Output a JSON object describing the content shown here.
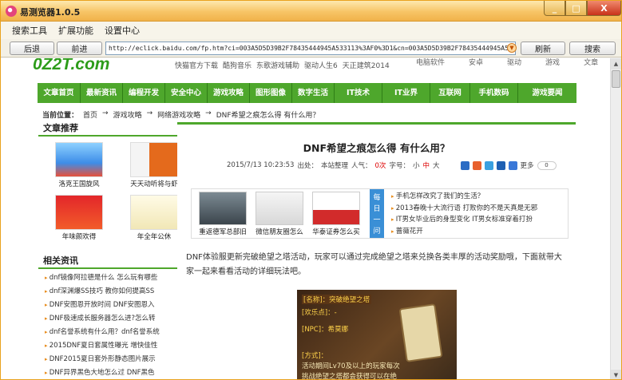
{
  "window": {
    "title": "易测览器1.0.5",
    "controls": [
      "_",
      "□",
      "X"
    ]
  },
  "menubar": {
    "items": [
      "搜索工具",
      "扩展功能",
      "设置中心"
    ]
  },
  "toolbar": {
    "back": "后退",
    "forward": "前进",
    "address": "http://eclick.baidu.com/fp.htm?ci=003A5D5D39B2F78435444945A533113%3AF0%3D1&cn=003A5D5D39B2F78435444945A533113%3AF0%3",
    "refresh": "刷新",
    "search": "搜索"
  },
  "site": {
    "logo": "0Z2T.com",
    "top_links": [
      "快猫官方下载",
      "酷狗音乐",
      "东歌游戏辅助",
      "驱动人生6",
      "天正建筑2014"
    ],
    "top_nav": [
      "电脑软件",
      "安卓",
      "驱动",
      "游戏",
      "文章"
    ],
    "categories": [
      "文章首页",
      "最新资讯",
      "编程开发",
      "安全中心",
      "游戏攻略",
      "图形图像",
      "数字生活",
      "IT技术",
      "IT业界",
      "互联网",
      "手机数码",
      "游戏要闻"
    ],
    "breadcrumb": {
      "label": "当前位置：",
      "items": [
        "首页",
        "游戏攻略",
        "网络游戏攻略",
        "DNF希望之痕怎么得 有什么用？"
      ],
      "sep": "→"
    }
  },
  "sidebar": {
    "recommend_title": "文章推荐",
    "recommend": [
      {
        "caption": "洛克王国旋风"
      },
      {
        "caption": "天天动听将与虾"
      },
      {
        "caption": "年味颇欢得"
      },
      {
        "caption": "年全年公休"
      }
    ],
    "related_title": "相关资讯",
    "related": [
      "dnf镜像阿拉德是什么 怎么玩有哪些",
      "dnf深渊爆SS技巧 教你如何提高SS",
      "DNF安图恩开放时间 DNF安图恩入",
      "DNF极速成长服务器怎么进?怎么转",
      "dnf名誉系统有什么用？dnf名誉系统",
      "2015DNF夏日套属性曝光 增快佳性",
      "DNF2015夏日套外形静态图片展示",
      "DNF异界黑色大地怎么过 DNF黑色"
    ]
  },
  "article": {
    "title": "DNF希望之痕怎么得 有什么用？",
    "date": "2015/7/13 10:23:53",
    "source_label": "出处：",
    "source": "本站整理",
    "popularity_label": "人气：",
    "popularity": "0次",
    "font_label": "字号：",
    "font_small": "小",
    "font_medium": "中",
    "font_large": "大",
    "share_more": "更多",
    "share_count": "0",
    "featured": [
      {
        "caption": "重返德军总部旧"
      },
      {
        "caption": "微信朋友圈怎么"
      },
      {
        "caption": "华泰证券怎么买"
      }
    ],
    "daily_tag": [
      "每",
      "日",
      "一",
      "问"
    ],
    "daily": [
      "手机怎样改究了我们的生活？",
      "2013春晚十大流行语 打败你的不是天真是无邪",
      "IT男女毕业后的身型变化 IT男女标准穿着打扮",
      "蔷薇花开"
    ],
    "body": "DNF体验服更新完破绝望之塔活动，玩家可以通过完成绝望之塔来兑换各类丰厚的活动奖励哦，下面就带大家一起来看看活动的详细玩法吧。",
    "image_lines": {
      "name_label": "[名称]：",
      "name": "突破绝望之塔",
      "points_label": "[欢乐点]：",
      "points": "-",
      "npc_label": "[NPC]：",
      "npc": "希莫娜",
      "method_label": "[方式]：",
      "method1": "活动期间Lv70及以上的玩家每次",
      "method2": "挑战绝望之塔都会获得可以在绝"
    }
  },
  "colors": {
    "green": "#4ea72c",
    "accent_red": "#dd0000",
    "title_orange": "#f0b24a",
    "blue_tag": "#3a8fd6"
  }
}
